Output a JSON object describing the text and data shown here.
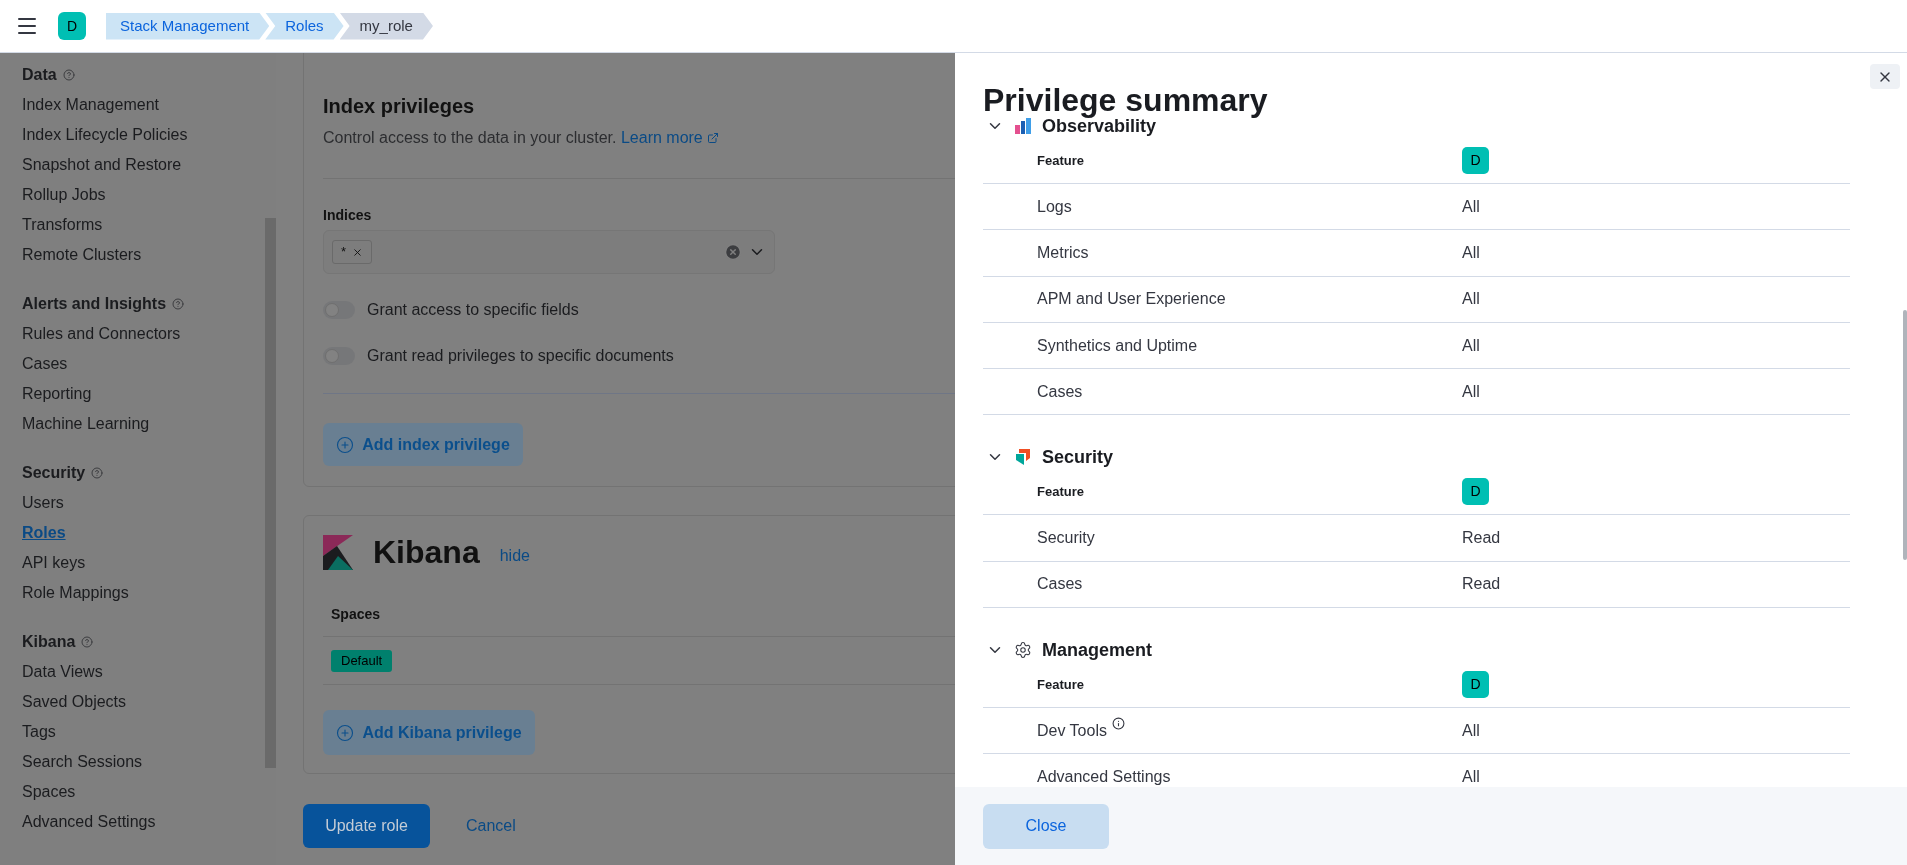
{
  "header": {
    "avatar": "D",
    "breadcrumbs": [
      {
        "label": "Stack Management",
        "selected": false
      },
      {
        "label": "Roles",
        "selected": false
      },
      {
        "label": "my_role",
        "selected": true
      }
    ]
  },
  "sidebar": {
    "sections": [
      {
        "title": "Data",
        "items": [
          {
            "label": "Index Management",
            "selected": false
          },
          {
            "label": "Index Lifecycle Policies",
            "selected": false
          },
          {
            "label": "Snapshot and Restore",
            "selected": false
          },
          {
            "label": "Rollup Jobs",
            "selected": false
          },
          {
            "label": "Transforms",
            "selected": false
          },
          {
            "label": "Remote Clusters",
            "selected": false
          }
        ]
      },
      {
        "title": "Alerts and Insights",
        "items": [
          {
            "label": "Rules and Connectors",
            "selected": false
          },
          {
            "label": "Cases",
            "selected": false
          },
          {
            "label": "Reporting",
            "selected": false
          },
          {
            "label": "Machine Learning",
            "selected": false
          }
        ]
      },
      {
        "title": "Security",
        "items": [
          {
            "label": "Users",
            "selected": false
          },
          {
            "label": "Roles",
            "selected": true
          },
          {
            "label": "API keys",
            "selected": false
          },
          {
            "label": "Role Mappings",
            "selected": false
          }
        ]
      },
      {
        "title": "Kibana",
        "items": [
          {
            "label": "Data Views",
            "selected": false
          },
          {
            "label": "Saved Objects",
            "selected": false
          },
          {
            "label": "Tags",
            "selected": false
          },
          {
            "label": "Search Sessions",
            "selected": false
          },
          {
            "label": "Spaces",
            "selected": false
          },
          {
            "label": "Advanced Settings",
            "selected": false
          }
        ]
      }
    ]
  },
  "index_privileges": {
    "title": "Index privileges",
    "description": "Control access to the data in your cluster.",
    "link": "Learn more",
    "indices_label": "Indices",
    "indices": [
      "*"
    ],
    "toggles": [
      {
        "label": "Grant access to specific fields",
        "on": false
      },
      {
        "label": "Grant read privileges to specific documents",
        "on": false
      }
    ],
    "add_button": "Add index privilege"
  },
  "kibana": {
    "title": "Kibana",
    "hide_link": "hide",
    "spaces_header": "Spaces",
    "spaces": [
      "Default"
    ],
    "add_button": "Add Kibana privilege"
  },
  "actions": {
    "primary": "Update role",
    "secondary": "Cancel"
  },
  "flyout": {
    "title": "Privilege summary",
    "sections": [
      {
        "title": "Observability",
        "feature_header": "Feature",
        "space": "D",
        "rows": [
          {
            "feature": "Logs",
            "privilege": "All",
            "info": false
          },
          {
            "feature": "Metrics",
            "privilege": "All",
            "info": false
          },
          {
            "feature": "APM and User Experience",
            "privilege": "All",
            "info": false
          },
          {
            "feature": "Synthetics and Uptime",
            "privilege": "All",
            "info": false
          },
          {
            "feature": "Cases",
            "privilege": "All",
            "info": false
          }
        ]
      },
      {
        "title": "Security",
        "feature_header": "Feature",
        "space": "D",
        "rows": [
          {
            "feature": "Security",
            "privilege": "Read",
            "info": false
          },
          {
            "feature": "Cases",
            "privilege": "Read",
            "info": false
          }
        ]
      },
      {
        "title": "Management",
        "feature_header": "Feature",
        "space": "D",
        "rows": [
          {
            "feature": "Dev Tools",
            "privilege": "All",
            "info": true
          },
          {
            "feature": "Advanced Settings",
            "privilege": "All",
            "info": false
          }
        ]
      }
    ],
    "close_button": "Close"
  }
}
